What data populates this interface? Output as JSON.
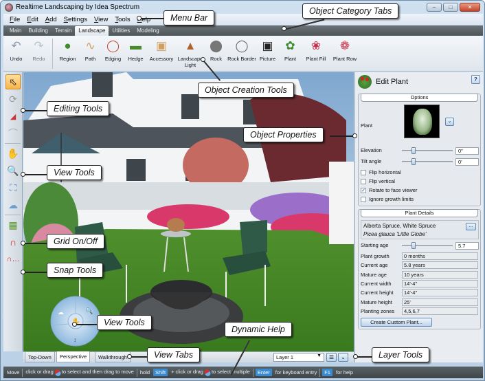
{
  "window": {
    "title": "Realtime Landscaping by Idea Spectrum",
    "controls": [
      "minimize",
      "maximize",
      "close"
    ]
  },
  "menubar": {
    "items": [
      {
        "label": "File",
        "accel": "F"
      },
      {
        "label": "Edit",
        "accel": "E"
      },
      {
        "label": "Add",
        "accel": "A"
      },
      {
        "label": "Settings",
        "accel": "S"
      },
      {
        "label": "View",
        "accel": "V"
      },
      {
        "label": "Tools",
        "accel": "T"
      },
      {
        "label": "Help",
        "accel": "H"
      }
    ]
  },
  "category_tabs": {
    "items": [
      "Main",
      "Building",
      "Terrain",
      "Landscape",
      "Utilities",
      "Modeling"
    ],
    "active": "Landscape"
  },
  "ribbon": {
    "history": [
      {
        "label": "Undo",
        "icon": "undo-icon",
        "enabled": true
      },
      {
        "label": "Redo",
        "icon": "redo-icon",
        "enabled": false
      }
    ],
    "tools": [
      {
        "label": "Region",
        "icon": "region-icon"
      },
      {
        "label": "Path",
        "icon": "path-icon"
      },
      {
        "label": "Edging",
        "icon": "edging-icon"
      },
      {
        "label": "Hedge",
        "icon": "hedge-icon"
      },
      {
        "label": "Accessory",
        "icon": "accessory-icon"
      },
      {
        "label": "Landscape Light",
        "icon": "landscape-light-icon"
      },
      {
        "label": "Rock",
        "icon": "rock-icon"
      },
      {
        "label": "Rock Border",
        "icon": "rock-border-icon"
      },
      {
        "label": "Picture",
        "icon": "camera-icon"
      },
      {
        "label": "Plant",
        "icon": "plant-icon"
      },
      {
        "label": "Plant Fill",
        "icon": "plant-fill-icon"
      },
      {
        "label": "Plant Row",
        "icon": "plant-row-icon"
      }
    ]
  },
  "left_toolbar": {
    "editing": [
      "select-arrow-icon",
      "rotate-icon",
      "resize-icon",
      "arc-icon"
    ],
    "view": [
      "pan-hand-icon",
      "zoom-icon",
      "zoom-extents-icon",
      "orbit-icon"
    ],
    "grid": [
      "grid-icon"
    ],
    "snap": [
      "magnet-icon",
      "magnet-options-icon"
    ]
  },
  "view_tabs": {
    "items": [
      "Top-Down",
      "Perspective",
      "Walkthrough"
    ],
    "active": "Perspective"
  },
  "layer_tools": {
    "selected_layer": "Layer 1"
  },
  "properties_panel": {
    "title": "Edit Plant",
    "help_label": "?",
    "options": {
      "header": "Options",
      "plant_label": "Plant",
      "elevation_label": "Elevation",
      "elevation_value": "0\"",
      "elevation_slider": 0.2,
      "tilt_label": "Tilt angle",
      "tilt_value": "0'",
      "tilt_slider": 0.2,
      "checkboxes": [
        {
          "label": "Flip horizontal",
          "checked": false
        },
        {
          "label": "Flip vertical",
          "checked": false
        },
        {
          "label": "Rotate to face viewer",
          "checked": true
        },
        {
          "label": "Ignore growth limits",
          "checked": false
        }
      ]
    },
    "details": {
      "header": "Plant Details",
      "common_name": "Alberta Spruce, White Spruce",
      "botanical_name": "Picea glauca 'Little Globe'",
      "more_label": "...",
      "starting_age_label": "Starting age",
      "starting_age_value": "5.7",
      "starting_age_slider": 0.2,
      "rows": [
        {
          "label": "Plant growth",
          "value": "0 months"
        },
        {
          "label": "Current age",
          "value": "5.8 years"
        },
        {
          "label": "Mature age",
          "value": "10 years"
        },
        {
          "label": "Current width",
          "value": "14'-4\""
        },
        {
          "label": "Current height",
          "value": "14'-4\""
        },
        {
          "label": "Mature height",
          "value": "25'"
        },
        {
          "label": "Planting zones",
          "value": "4,5,6,7"
        }
      ],
      "custom_button": "Create Custom Plant..."
    }
  },
  "statusbar": {
    "mode": "Move",
    "hint1": "click or drag",
    "hint1b": "to select and then drag to move",
    "hold": "hold",
    "shift_key": "Shift",
    "hint2": "+ click or drag",
    "hint2b": "to select multiple",
    "enter_key": "Enter",
    "enter_hint": "for keyboard entry",
    "f1_key": "F1",
    "f1_hint": "for help"
  },
  "callouts": {
    "menu_bar": "Menu Bar",
    "category_tabs": "Object Category Tabs",
    "creation_tools": "Object Creation Tools",
    "object_properties": "Object Properties",
    "editing_tools": "Editing Tools",
    "view_tools_left": "View Tools",
    "grid": "Grid On/Off",
    "snap": "Snap Tools",
    "view_tools_nav": "View Tools",
    "dynamic_help": "Dynamic Help",
    "view_tabs": "View Tabs",
    "layer_tools": "Layer Tools"
  }
}
